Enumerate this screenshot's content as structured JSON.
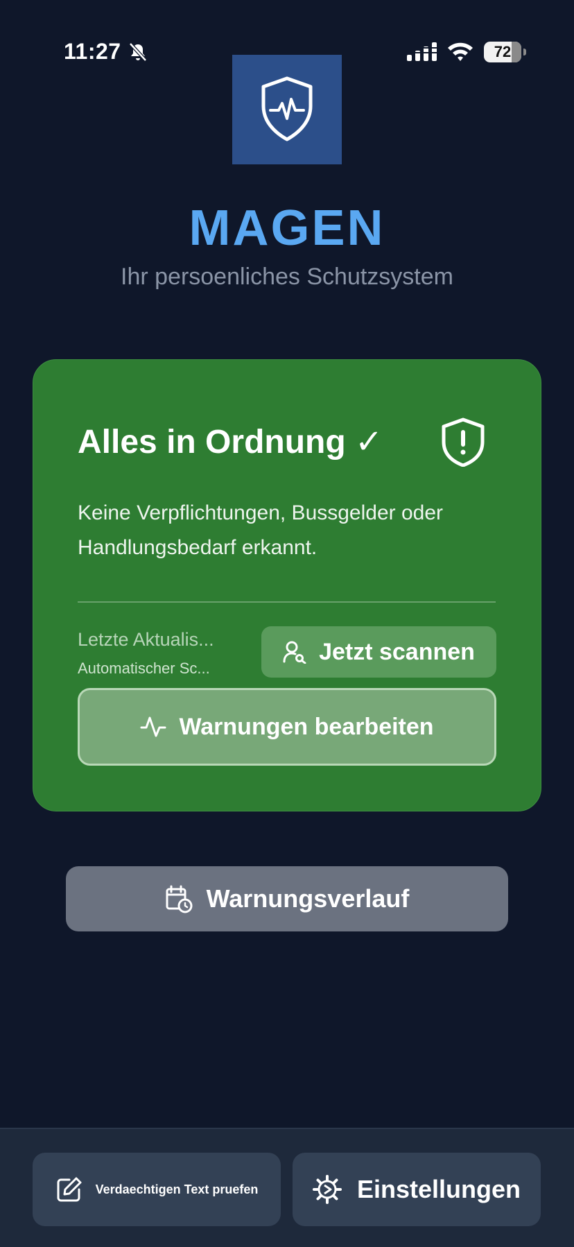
{
  "status_bar": {
    "time": "11:27",
    "battery": "72"
  },
  "app": {
    "title": "MAGEN",
    "subtitle": "Ihr persoenliches Schutzsystem"
  },
  "status_card": {
    "title": "Alles in Ordnung ✓",
    "description": "Keine Verpflichtungen, Bussgelder oder Handlungsbedarf erkannt.",
    "last_update": "Letzte Aktualis...",
    "auto_scan": "Automatischer Sc...",
    "scan_button": "Jetzt scannen",
    "edit_button": "Warnungen bearbeiten",
    "color": "#2e7d32"
  },
  "history_button": "Warnungsverlauf",
  "bottom_nav": {
    "check_text": "Verdaechtigen Text pruefen",
    "settings": "Einstellungen"
  },
  "icons": {
    "logo": "shield-pulse-icon",
    "status": "shield-alert-icon",
    "scan": "user-search-icon",
    "edit": "activity-icon",
    "history": "calendar-clock-icon",
    "check": "edit-icon",
    "settings": "gear-icon"
  }
}
